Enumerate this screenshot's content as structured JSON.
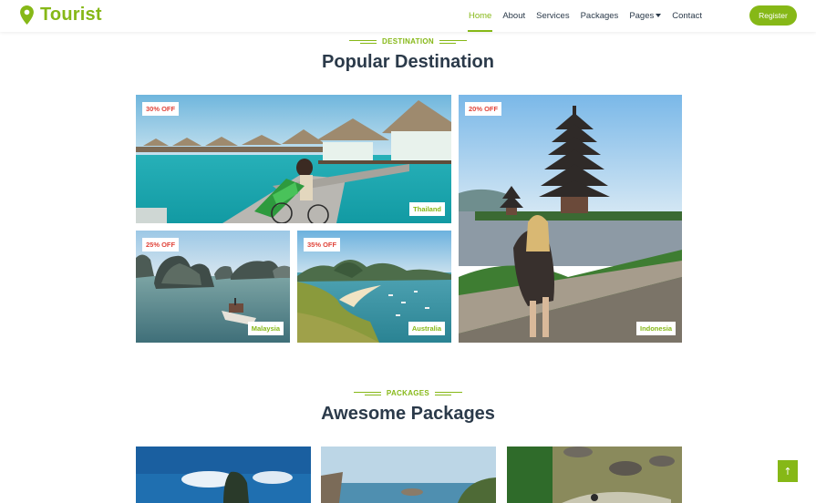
{
  "brand": {
    "name": "Tourist"
  },
  "nav": {
    "items": [
      {
        "label": "Home"
      },
      {
        "label": "About"
      },
      {
        "label": "Services"
      },
      {
        "label": "Packages"
      },
      {
        "label": "Pages"
      },
      {
        "label": "Contact"
      }
    ],
    "active": "Home",
    "register_label": "Register"
  },
  "destination_section": {
    "subtitle": "DESTINATION",
    "title": "Popular Destination",
    "tiles": [
      {
        "name": "Thailand",
        "discount": "30% OFF"
      },
      {
        "name": "Indonesia",
        "discount": "20% OFF"
      },
      {
        "name": "Malaysia",
        "discount": "25% OFF"
      },
      {
        "name": "Australia",
        "discount": "35% OFF"
      }
    ]
  },
  "packages_section": {
    "subtitle": "PACKAGES",
    "title": "Awesome Packages"
  },
  "back_to_top": {
    "icon": "arrow-up-icon",
    "glyph": "↑"
  },
  "colors": {
    "accent": "#86b817",
    "heading": "#2b3a4a",
    "discount": "#e0453b"
  }
}
